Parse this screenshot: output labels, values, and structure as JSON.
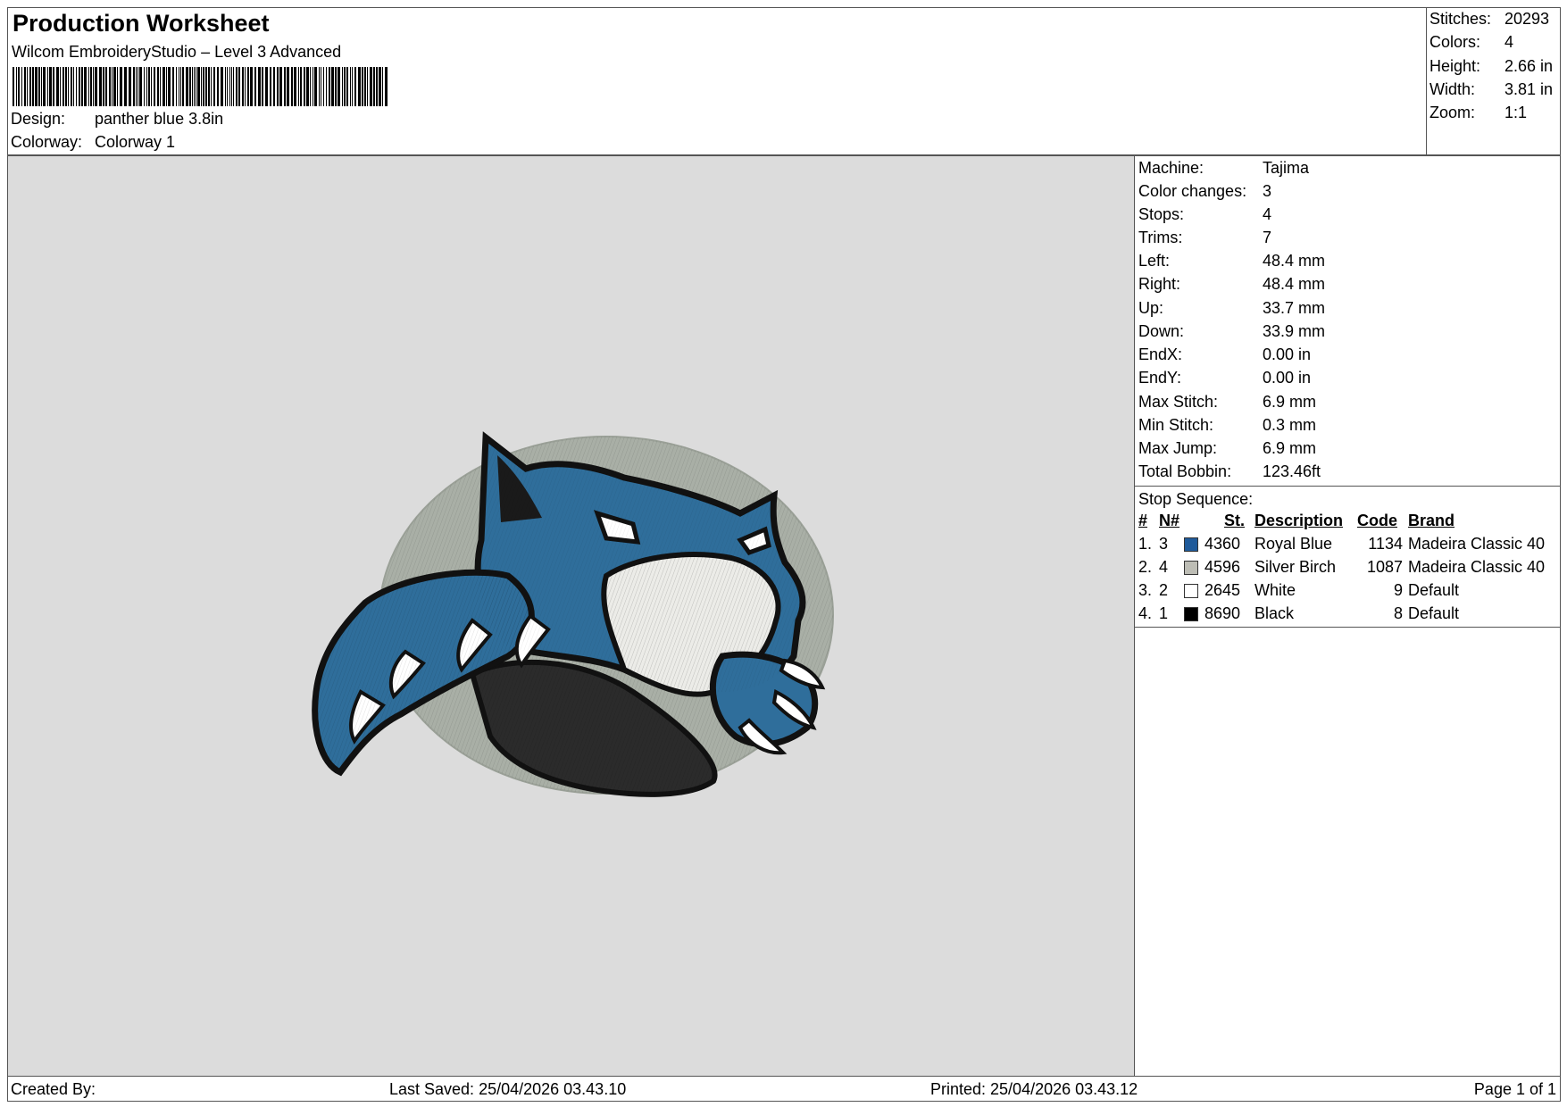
{
  "header": {
    "title": "Production Worksheet",
    "subtitle": "Wilcom EmbroideryStudio – Level 3 Advanced",
    "design_label": "Design:",
    "design_value": "panther blue 3.8in",
    "colorway_label": "Colorway:",
    "colorway_value": "Colorway 1"
  },
  "summary": [
    {
      "label": "Stitches:",
      "value": "20293"
    },
    {
      "label": "Colors:",
      "value": "4"
    },
    {
      "label": "Height:",
      "value": "2.66 in"
    },
    {
      "label": "Width:",
      "value": "3.81 in"
    },
    {
      "label": "Zoom:",
      "value": "1:1"
    }
  ],
  "machine_info": [
    {
      "label": "Machine:",
      "value": "Tajima"
    },
    {
      "label": "Color changes:",
      "value": "3"
    },
    {
      "label": "Stops:",
      "value": "4"
    },
    {
      "label": "Trims:",
      "value": "7"
    },
    {
      "label": "Left:",
      "value": "48.4 mm"
    },
    {
      "label": "Right:",
      "value": "48.4 mm"
    },
    {
      "label": "Up:",
      "value": "33.7 mm"
    },
    {
      "label": "Down:",
      "value": "33.9 mm"
    },
    {
      "label": "EndX:",
      "value": "0.00 in"
    },
    {
      "label": "EndY:",
      "value": "0.00 in"
    },
    {
      "label": "Max Stitch:",
      "value": "6.9 mm"
    },
    {
      "label": "Min Stitch:",
      "value": "0.3 mm"
    },
    {
      "label": "Max Jump:",
      "value": "6.9 mm"
    },
    {
      "label": "Total Bobbin:",
      "value": "123.46ft"
    }
  ],
  "stop_sequence": {
    "title": "Stop Sequence:",
    "headers": {
      "num": "#",
      "n": "N#",
      "st": "St.",
      "description": "Description",
      "code": "Code",
      "brand": "Brand"
    },
    "rows": [
      {
        "num": "1.",
        "n": "3",
        "color": "#1f5a9a",
        "st": "4360",
        "description": "Royal Blue",
        "code": "1134",
        "brand": "Madeira Classic 40"
      },
      {
        "num": "2.",
        "n": "4",
        "color": "#bdbdb5",
        "st": "4596",
        "description": "Silver Birch",
        "code": "1087",
        "brand": "Madeira Classic 40"
      },
      {
        "num": "3.",
        "n": "2",
        "color": "#ffffff",
        "st": "2645",
        "description": "White",
        "code": "9",
        "brand": "Default"
      },
      {
        "num": "4.",
        "n": "1",
        "color": "#000000",
        "st": "8690",
        "description": "Black",
        "code": "8",
        "brand": "Default"
      }
    ]
  },
  "footer": {
    "created_by": "Created By:",
    "last_saved": "Last Saved: 25/04/2026 03.43.10",
    "printed": "Printed: 25/04/2026 03.43.12",
    "page": "Page 1 of 1"
  },
  "colors": {
    "canvas_bg": "#dcdcdc",
    "panther_blue": "#2f6e9b",
    "backdrop_oval": "#a9afa6",
    "outline": "#111111"
  }
}
